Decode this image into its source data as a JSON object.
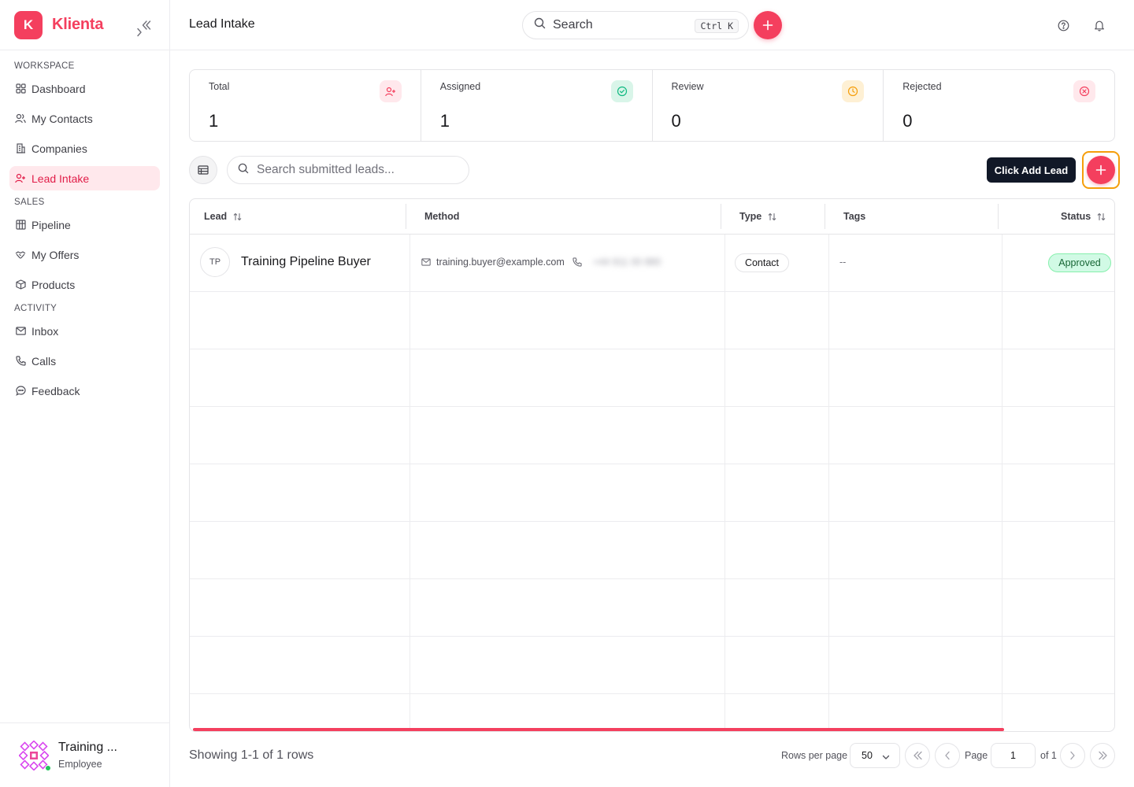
{
  "app": {
    "logo_letter": "K",
    "name": "Klienta"
  },
  "sidebar": {
    "sections": [
      {
        "label": "WORKSPACE",
        "items": [
          {
            "label": "Dashboard",
            "icon": "grid-icon"
          },
          {
            "label": "My Contacts",
            "icon": "users-icon"
          },
          {
            "label": "Companies",
            "icon": "building-icon"
          },
          {
            "label": "Lead Intake",
            "icon": "user-plus-icon",
            "active": true
          }
        ]
      },
      {
        "label": "SALES",
        "items": [
          {
            "label": "Pipeline",
            "icon": "kanban-icon"
          },
          {
            "label": "My Offers",
            "icon": "handshake-icon"
          },
          {
            "label": "Products",
            "icon": "package-icon"
          }
        ]
      },
      {
        "label": "ACTIVITY",
        "items": [
          {
            "label": "Inbox",
            "icon": "mail-icon"
          },
          {
            "label": "Calls",
            "icon": "phone-icon"
          },
          {
            "label": "Feedback",
            "icon": "message-icon"
          }
        ]
      }
    ],
    "user": {
      "name": "Training ...",
      "role": "Employee"
    }
  },
  "header": {
    "title": "Lead Intake",
    "search_placeholder": "Search",
    "shortcut": "Ctrl K"
  },
  "stats": [
    {
      "label": "Total",
      "value": "1",
      "icon": "user-plus-icon",
      "color": "#f43f5e",
      "bg": "#ffe8ec"
    },
    {
      "label": "Assigned",
      "value": "1",
      "icon": "check-circle-icon",
      "color": "#10b981",
      "bg": "#d9f5e9"
    },
    {
      "label": "Review",
      "value": "0",
      "icon": "clock-icon",
      "color": "#f59e0b",
      "bg": "#fef0d4"
    },
    {
      "label": "Rejected",
      "value": "0",
      "icon": "x-circle-icon",
      "color": "#f43f5e",
      "bg": "#ffe8ec"
    }
  ],
  "toolbar": {
    "search_placeholder": "Search submitted leads...",
    "tooltip": "Click Add Lead"
  },
  "table": {
    "columns": [
      {
        "label": "Lead",
        "sortable": true
      },
      {
        "label": "Method",
        "sortable": false
      },
      {
        "label": "Type",
        "sortable": true
      },
      {
        "label": "Tags",
        "sortable": false
      },
      {
        "label": "Status",
        "sortable": true
      }
    ],
    "rows": [
      {
        "initials": "TP",
        "name": "Training Pipeline Buyer",
        "email": "training.buyer@example.com",
        "phone": "+44 911 00 880",
        "type": "Contact",
        "tags": "--",
        "status": "Approved"
      }
    ]
  },
  "pagination": {
    "showing": "Showing 1-1 of 1 rows",
    "rows_per_page_label": "Rows per page",
    "rows_per_page": "50",
    "page_label": "Page",
    "page": "1",
    "of_label": "of 1"
  },
  "colors": {
    "accent": "#f43f5e",
    "highlight": "#f59e0b"
  }
}
